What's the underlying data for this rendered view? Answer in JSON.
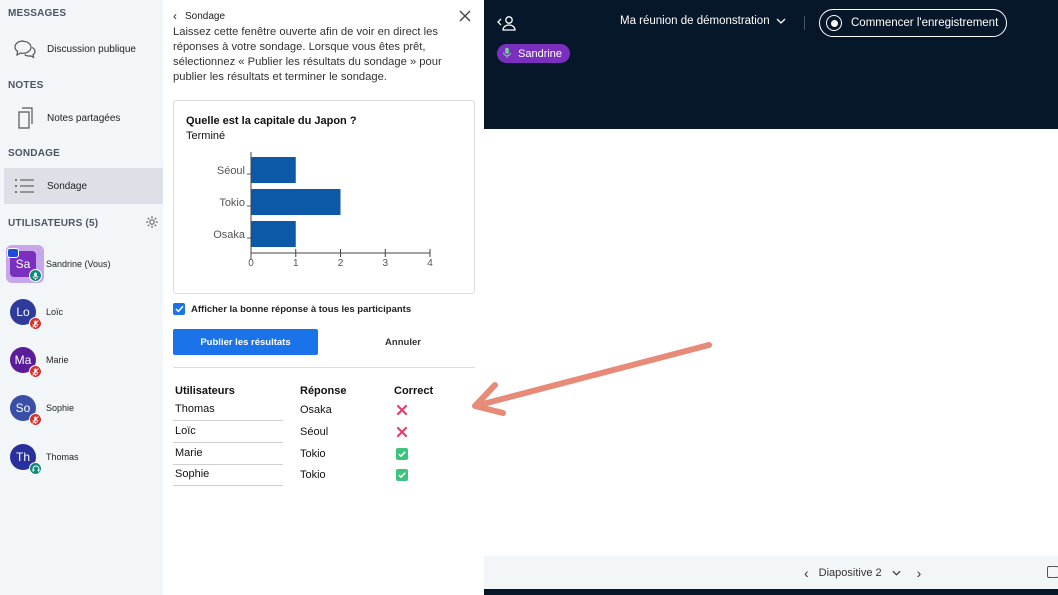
{
  "sidebar": {
    "messages_title": "MESSAGES",
    "public_chat": "Discussion publique",
    "notes_title": "NOTES",
    "shared_notes": "Notes partagées",
    "poll_title": "SONDAGE",
    "poll_item": "Sondage",
    "users_title": "UTILISATEURS (5)",
    "users": [
      {
        "initials": "Sa",
        "name": "Sandrine (Vous)",
        "color": "#7b2fbe",
        "badge_color": "#0f8a7a"
      },
      {
        "initials": "Lo",
        "name": "Loïc",
        "color": "#2e3a9c",
        "badge_color": "#d9322c"
      },
      {
        "initials": "Ma",
        "name": "Marie",
        "color": "#5a1c99",
        "badge_color": "#d9322c"
      },
      {
        "initials": "So",
        "name": "Sophie",
        "color": "#3a4fa8",
        "badge_color": "#d9322c"
      },
      {
        "initials": "Th",
        "name": "Thomas",
        "color": "#2a2f9e",
        "badge_color": "#0f8a7a"
      }
    ]
  },
  "poll": {
    "back_label": "Sondage",
    "intro": "Laissez cette fenêtre ouverte afin de voir en direct les réponses à votre sondage. Lorsque vous êtes prêt, sélectionnez « Publier les résultats du sondage » pour publier les résultats et terminer le sondage.",
    "question": "Quelle est la capitale du Japon ?",
    "status": "Terminé",
    "show_answer_label": "Afficher la bonne réponse à tous les participants",
    "publish_label": "Publier les résultats",
    "cancel_label": "Annuler",
    "table": {
      "headers": [
        "Utilisateurs",
        "Réponse",
        "Correct"
      ],
      "rows": [
        {
          "user": "Thomas",
          "answer": "Osaka",
          "correct": false
        },
        {
          "user": "Loïc",
          "answer": "Séoul",
          "correct": false
        },
        {
          "user": "Marie",
          "answer": "Tokio",
          "correct": true
        },
        {
          "user": "Sophie",
          "answer": "Tokio",
          "correct": true
        }
      ]
    }
  },
  "chart_data": {
    "type": "bar",
    "orientation": "horizontal",
    "categories": [
      "Séoul",
      "Tokio",
      "Osaka"
    ],
    "values": [
      1,
      2,
      1
    ],
    "xlim": [
      0,
      4
    ],
    "xticks": [
      0,
      1,
      2,
      3,
      4
    ],
    "title": "Quelle est la capitale du Japon ?",
    "bar_color": "#0c59a8"
  },
  "main": {
    "meeting_title": "Ma réunion de démonstration",
    "record_label": "Commencer l'enregistrement",
    "talker": "Sandrine",
    "slide_label": "Diapositive 2"
  },
  "colors": {
    "primary": "#1a73e8",
    "dark": "#06172a",
    "wrong": "#e53e6b",
    "right": "#3cc47c",
    "arrow": "#e88a78"
  }
}
